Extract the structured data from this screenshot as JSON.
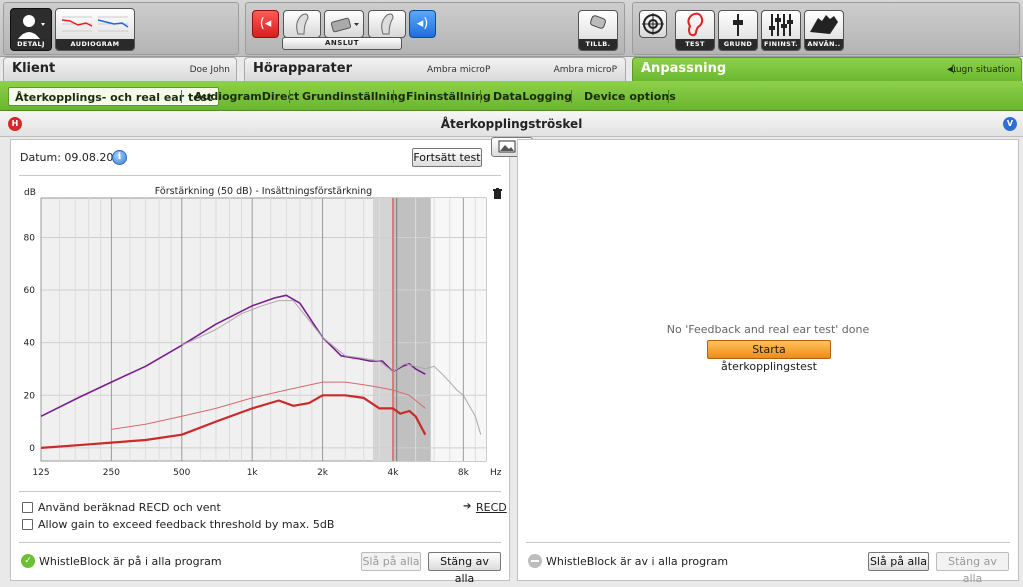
{
  "toolbar": {
    "detalj_label": "DETALJ",
    "audiogram_label": "AUDIOGRAM",
    "anslut_label": "ANSLUT",
    "tillb_label": "TILLB.",
    "test_label": "TEST",
    "grund_label": "GRUND",
    "fininst_label": "FININST.",
    "anvan_label": "ANVÄN.."
  },
  "header": {
    "klient_title": "Klient",
    "klient_name": "Doe John",
    "horapparater_title": "Hörapparater",
    "device_left": "Ambra microP",
    "device_right": "Ambra microP",
    "anpassning_title": "Anpassning",
    "situation_label": "Lugn situation"
  },
  "subtabs": [
    {
      "label": "Återkopplings- och real ear test",
      "active": true
    },
    {
      "label": "AudiogramDirect",
      "active": false
    },
    {
      "label": "Grundinställning",
      "active": false
    },
    {
      "label": "Fininställning",
      "active": false
    },
    {
      "label": "DataLogging",
      "active": false
    },
    {
      "label": "Device options",
      "active": false
    }
  ],
  "section": {
    "title": "Återkopplingströskel",
    "left_badge": "H",
    "right_badge": "V"
  },
  "left_panel": {
    "date_label": "Datum: 09.08.2011",
    "info_glyph": "i",
    "continue_button": "Fortsätt test",
    "checkbox_recd": "Använd beräknad  RECD och vent",
    "checkbox_gain": "Allow gain to exceed feedback threshold by max. 5dB",
    "recd_link": "RECD",
    "whistle_status": "WhistleBlock är på i alla program",
    "btn_on_all": "Slå på alla",
    "btn_off_all": "Stäng av alla"
  },
  "right_panel": {
    "empty_message": "No 'Feedback and real ear test' done",
    "start_button": "Starta återkopplingstest",
    "whistle_status": "WhistleBlock är av i alla program",
    "btn_on_all": "Slå på alla",
    "btn_off_all": "Stäng av alla"
  },
  "colors": {
    "accent_green": "#7cc43d",
    "series_purple": "#7a1e8e",
    "series_red": "#cc2a2a",
    "feedback_marker": "#d83a3a"
  },
  "chart_data": {
    "type": "line",
    "title": "Förstärkning (50 dB) - Insättningsförstärkning",
    "ylabel": "dB",
    "xlabel": "Hz",
    "x_scale": "log",
    "xlim": [
      125,
      10000
    ],
    "ylim": [
      -5,
      95
    ],
    "x_ticks": [
      125,
      250,
      500,
      1000,
      2000,
      4000,
      8000
    ],
    "x_tick_labels": [
      "125",
      "250",
      "500",
      "1k",
      "2k",
      "4k",
      "8k"
    ],
    "y_ticks": [
      0,
      20,
      40,
      60,
      80
    ],
    "grid": true,
    "series": [
      {
        "color": "#7a1e8e",
        "width": 1.6,
        "x": [
          125,
          180,
          250,
          350,
          500,
          700,
          1000,
          1250,
          1400,
          1600,
          2000,
          2400,
          2800,
          3200,
          3600,
          4000,
          4400,
          4700,
          5000,
          5500
        ],
        "y": [
          12,
          19,
          25,
          31,
          39,
          47,
          54,
          57,
          58,
          55,
          42,
          35,
          34,
          33,
          33,
          29,
          31,
          32,
          30,
          28
        ]
      },
      {
        "color": "#cc2a2a",
        "width": 2.2,
        "x": [
          125,
          180,
          250,
          350,
          500,
          700,
          1000,
          1300,
          1500,
          1750,
          2000,
          2500,
          3000,
          3500,
          4000,
          4300,
          4700,
          5000,
          5500
        ],
        "y": [
          0,
          1,
          2,
          3,
          5,
          10,
          15,
          18,
          16,
          17,
          20,
          20,
          19,
          15,
          15,
          13,
          14,
          12,
          5
        ]
      },
      {
        "color": "#d86a6a",
        "width": 1,
        "x": [
          250,
          350,
          500,
          700,
          1000,
          1400,
          2000,
          2500,
          3000,
          3500,
          4000,
          4700,
          5500
        ],
        "y": [
          7,
          9,
          12,
          15,
          19,
          22,
          25,
          25,
          24,
          23,
          22,
          20,
          15
        ]
      },
      {
        "color": "#aaaaaa",
        "width": 1,
        "x": [
          500,
          700,
          900,
          1100,
          1300,
          1500,
          2000,
          2500,
          3000,
          3500,
          4000,
          4500,
          5000,
          5500,
          6000,
          6500,
          7000,
          7500,
          8000,
          9000,
          9500
        ],
        "y": [
          39,
          45,
          51,
          54,
          56,
          56,
          42,
          35,
          34,
          33,
          29,
          32,
          31,
          30,
          31,
          28,
          25,
          22,
          20,
          12,
          5
        ]
      }
    ],
    "feedback_markers_hz": [
      4000,
      4150
    ]
  }
}
